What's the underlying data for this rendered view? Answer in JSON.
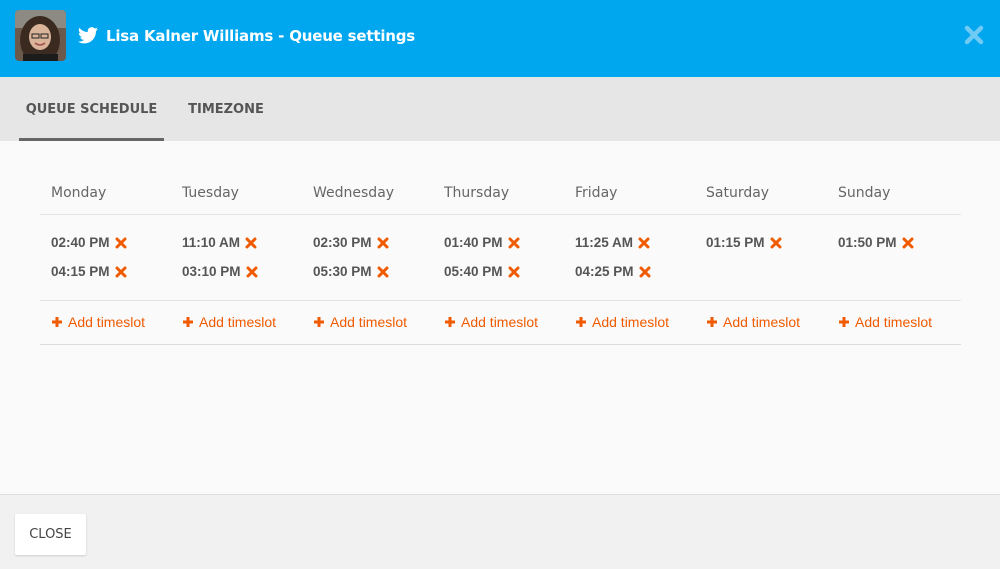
{
  "header": {
    "title": "Lisa Kalner Williams - Queue settings",
    "bg_color": "#00a6ee",
    "avatar_icon": "user-avatar-photo",
    "network_icon": "twitter-bird-icon",
    "close_icon": "close-x-icon"
  },
  "tabs": [
    {
      "label": "QUEUE SCHEDULE",
      "active": true
    },
    {
      "label": "TIMEZONE",
      "active": false
    }
  ],
  "schedule": {
    "days": [
      {
        "name": "Monday",
        "slots": [
          "02:40 PM",
          "04:15 PM"
        ]
      },
      {
        "name": "Tuesday",
        "slots": [
          "11:10 AM",
          "03:10 PM"
        ]
      },
      {
        "name": "Wednesday",
        "slots": [
          "02:30 PM",
          "05:30 PM"
        ]
      },
      {
        "name": "Thursday",
        "slots": [
          "01:40 PM",
          "05:40 PM"
        ]
      },
      {
        "name": "Friday",
        "slots": [
          "11:25 AM",
          "04:25 PM"
        ]
      },
      {
        "name": "Saturday",
        "slots": [
          "01:15 PM"
        ]
      },
      {
        "name": "Sunday",
        "slots": [
          "01:50 PM"
        ]
      }
    ],
    "add_label": "Add timeslot",
    "accent_color": "#f05a00"
  },
  "footer": {
    "close_label": "CLOSE"
  }
}
